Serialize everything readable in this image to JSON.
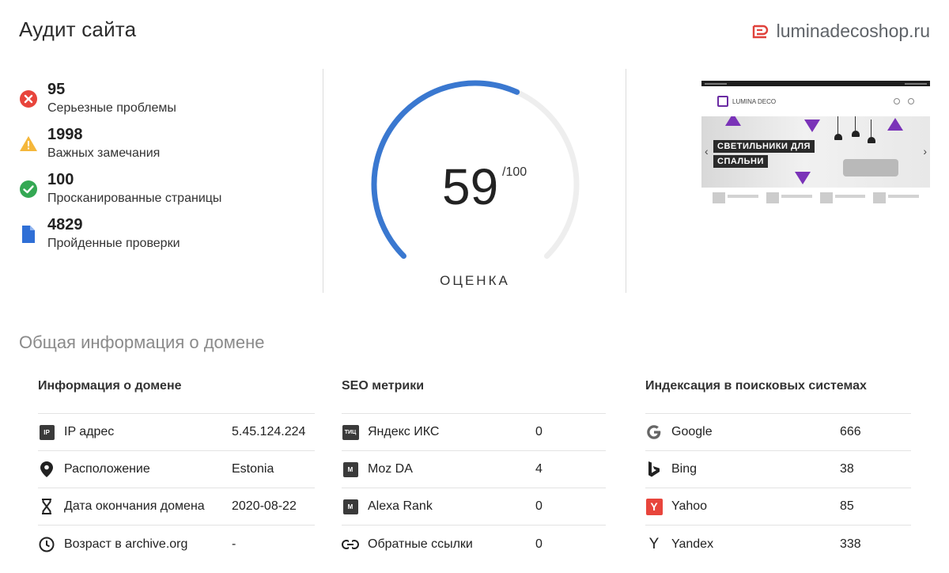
{
  "header": {
    "title": "Аудит сайта",
    "domain": "luminadecoshop.ru",
    "brand_color": "#e0413b"
  },
  "stats": [
    {
      "value": "95",
      "label": "Серьезные проблемы",
      "icon": "error-circle-icon",
      "color": "#e8453c"
    },
    {
      "value": "1998",
      "label": "Важных замечания",
      "icon": "warning-triangle-icon",
      "color": "#f5b73b"
    },
    {
      "value": "100",
      "label": "Просканированные страницы",
      "icon": "check-circle-icon",
      "color": "#34a853"
    },
    {
      "value": "4829",
      "label": "Пройденные проверки",
      "icon": "document-icon",
      "color": "#2f6fd6"
    }
  ],
  "score": {
    "value": "59",
    "max": "/100",
    "label": "ОЦЕНКА",
    "fraction": 0.59,
    "color": "#3a78d0",
    "track_color": "#eeeeee"
  },
  "preview": {
    "logo_text": "LUMINA DECO",
    "banner_line1": "СВЕТИЛЬНИКИ ДЛЯ",
    "banner_line2": "СПАЛЬНИ",
    "accent_color": "#7a33b8"
  },
  "domain_info": {
    "section_title": "Общая информация о домене",
    "columns": [
      {
        "title": "Информация о домене",
        "rows": [
          {
            "icon": "ip-icon",
            "icon_text": "IP",
            "label": "IP адрес",
            "value": "5.45.124.224"
          },
          {
            "icon": "location-pin-icon",
            "label": "Расположение",
            "value": "Estonia"
          },
          {
            "icon": "hourglass-icon",
            "label": "Дата окончания домена",
            "value": "2020-08-22"
          },
          {
            "icon": "clock-icon",
            "label": "Возраст в archive.org",
            "value": "-"
          }
        ]
      },
      {
        "title": "SEO метрики",
        "rows": [
          {
            "icon": "yandex-iks-icon",
            "icon_text": "ТИЦ",
            "label": "Яндекс ИКС",
            "value": "0"
          },
          {
            "icon": "moz-icon",
            "icon_text": "M",
            "label": "Moz DA",
            "value": "4"
          },
          {
            "icon": "alexa-icon",
            "icon_text": "M",
            "label": "Alexa Rank",
            "value": "0"
          },
          {
            "icon": "link-icon",
            "label": "Обратные ссылки",
            "value": "0"
          }
        ]
      },
      {
        "title": "Индексация в поисковых системах",
        "rows": [
          {
            "icon": "google-icon",
            "label": "Google",
            "value": "666"
          },
          {
            "icon": "bing-icon",
            "label": "Bing",
            "value": "38"
          },
          {
            "icon": "yahoo-icon",
            "icon_text": "Y",
            "label": "Yahoo",
            "value": "85"
          },
          {
            "icon": "yandex-icon",
            "icon_text": "Y",
            "label": "Yandex",
            "value": "338"
          }
        ]
      }
    ]
  }
}
